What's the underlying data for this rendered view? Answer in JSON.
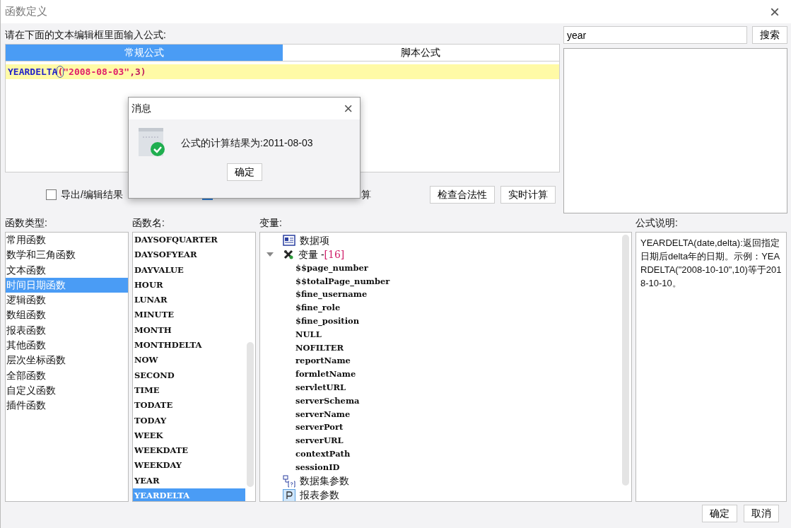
{
  "window": {
    "title": "函数定义",
    "close": "×"
  },
  "formula_prompt": "请在下面的文本编辑框里面输入公式:",
  "editor_tabs": [
    {
      "label": "常规公式",
      "selected": true
    },
    {
      "label": "脚本公式",
      "selected": false
    }
  ],
  "formula": [
    {
      "kind": "function",
      "text": "YEARDELTA"
    },
    {
      "kind": "paren",
      "text": "("
    },
    {
      "kind": "string",
      "text": "\"2008-08-03\""
    },
    {
      "kind": "punct",
      "text": ",3)"
    }
  ],
  "options": [
    {
      "label": "导出/编辑结果",
      "checked": false
    },
    {
      "label": "算",
      "checked": true
    }
  ],
  "actions": [
    "检查合法性",
    "实时计算"
  ],
  "search": {
    "value": "year",
    "button": "搜索"
  },
  "function_types": {
    "label": "函数类型:",
    "items": [
      {
        "label": "常用函数",
        "selected": false
      },
      {
        "label": "数学和三角函数",
        "selected": false
      },
      {
        "label": "文本函数",
        "selected": false
      },
      {
        "label": "时间日期函数",
        "selected": true
      },
      {
        "label": "逻辑函数",
        "selected": false
      },
      {
        "label": "数组函数",
        "selected": false
      },
      {
        "label": "报表函数",
        "selected": false
      },
      {
        "label": "其他函数",
        "selected": false
      },
      {
        "label": "层次坐标函数",
        "selected": false
      },
      {
        "label": "全部函数",
        "selected": false
      },
      {
        "label": "自定义函数",
        "selected": false
      },
      {
        "label": "插件函数",
        "selected": false
      }
    ]
  },
  "function_names": {
    "label": "函数名:",
    "items": [
      {
        "label": "DAYSOFQUARTER",
        "selected": false
      },
      {
        "label": "DAYSOFYEAR",
        "selected": false
      },
      {
        "label": "DAYVALUE",
        "selected": false
      },
      {
        "label": "HOUR",
        "selected": false
      },
      {
        "label": "LUNAR",
        "selected": false
      },
      {
        "label": "MINUTE",
        "selected": false
      },
      {
        "label": "MONTH",
        "selected": false
      },
      {
        "label": "MONTHDELTA",
        "selected": false
      },
      {
        "label": "NOW",
        "selected": false
      },
      {
        "label": "SECOND",
        "selected": false
      },
      {
        "label": "TIME",
        "selected": false
      },
      {
        "label": "TODATE",
        "selected": false
      },
      {
        "label": "TODAY",
        "selected": false
      },
      {
        "label": "WEEK",
        "selected": false
      },
      {
        "label": "WEEKDATE",
        "selected": false
      },
      {
        "label": "WEEKDAY",
        "selected": false
      },
      {
        "label": "YEAR",
        "selected": false
      },
      {
        "label": "YEARDELTA",
        "selected": true
      }
    ]
  },
  "variables": {
    "label": "变量:",
    "items": [
      {
        "kind": "data-item",
        "label": "数据项"
      },
      {
        "kind": "variable",
        "label": "变量 - ",
        "count": "[16]",
        "expanded": true,
        "children": [
          {
            "label": "$$page_number"
          },
          {
            "label": "$$totalPage_number"
          },
          {
            "label": "$fine_username"
          },
          {
            "label": "$fine_role"
          },
          {
            "label": "$fine_position"
          },
          {
            "label": "NULL"
          },
          {
            "label": "NOFILTER"
          },
          {
            "label": "reportName"
          },
          {
            "label": "formletName"
          },
          {
            "label": "servletURL"
          },
          {
            "label": "serverSchema"
          },
          {
            "label": "serverName"
          },
          {
            "label": "serverPort"
          },
          {
            "label": "serverURL"
          },
          {
            "label": "contextPath"
          },
          {
            "label": "sessionID"
          }
        ]
      },
      {
        "kind": "dataset-param",
        "label": "数据集参数"
      },
      {
        "kind": "report-param",
        "label": "报表参数"
      }
    ]
  },
  "description": {
    "label": "公式说明:",
    "text": "YEARDELTA(date,delta):返回指定日期后delta年的日期。示例：YEARDELTA(\"2008-10-10\",10)等于2018-10-10。"
  },
  "footer_buttons": [
    "确定",
    "取消"
  ],
  "message_dialog": {
    "title": "消息",
    "close": "×",
    "message": "公式的计算结果为:2011-08-03",
    "button": "确定"
  }
}
